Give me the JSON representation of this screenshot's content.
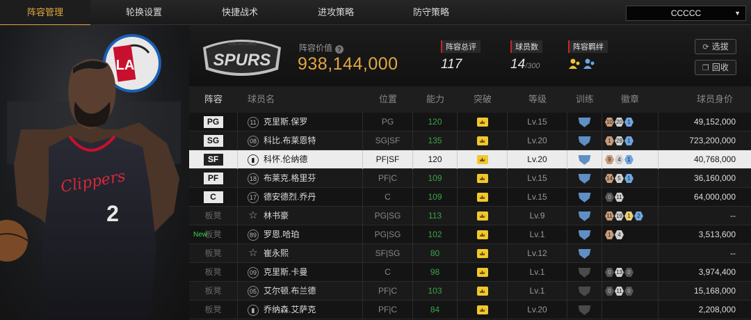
{
  "tabs": [
    {
      "label": "阵容管理",
      "active": true
    },
    {
      "label": "轮换设置"
    },
    {
      "label": "快捷战术"
    },
    {
      "label": "进攻策略"
    },
    {
      "label": "防守策略"
    }
  ],
  "team_select": {
    "value": "CCCCC"
  },
  "info": {
    "logo_text": "SPURS",
    "logo_arc": "SAN ANTONIO",
    "value_label": "阵容价值",
    "value": "938,144,000",
    "stats": [
      {
        "label": "阵容总评",
        "value": "117",
        "suffix": ""
      },
      {
        "label": "球员数",
        "value": "14",
        "suffix": "/300"
      },
      {
        "label": "阵容羁绊",
        "value": "",
        "suffix": ""
      }
    ],
    "buttons": {
      "select": "选拔",
      "recycle": "回收"
    }
  },
  "portrait": {
    "jersey_text": "Clippers",
    "jersey_number": "2",
    "logo_letters": "LA"
  },
  "table": {
    "headers": [
      "阵容",
      "球员名",
      "位置",
      "能力",
      "突破",
      "等级",
      "训练",
      "徽章",
      "球员身价"
    ],
    "rows": [
      {
        "slot": "PG",
        "starter": true,
        "num": "11",
        "name": "克里斯.保罗",
        "pos": "PG",
        "ability": "120",
        "green": true,
        "level": "Lv.15",
        "train": "blue",
        "badges": [
          [
            "b",
            "10"
          ],
          [
            "s",
            "20"
          ],
          [
            "bl",
            "1"
          ]
        ],
        "price": "49,152,000"
      },
      {
        "slot": "SG",
        "starter": true,
        "num": "08",
        "name": "科比.布莱恩特",
        "pos": "SG|SF",
        "ability": "135",
        "green": true,
        "level": "Lv.20",
        "train": "blue",
        "badges": [
          [
            "b",
            "1"
          ],
          [
            "s",
            "29"
          ],
          [
            "bl",
            "1"
          ]
        ],
        "price": "723,200,000"
      },
      {
        "slot": "SF",
        "starter": true,
        "selected": true,
        "num": "il",
        "name": "科怀.伦纳德",
        "pos": "PF|SF",
        "ability": "120",
        "green": false,
        "level": "Lv.20",
        "train": "blue",
        "badges": [
          [
            "b",
            "9"
          ],
          [
            "s",
            "4"
          ],
          [
            "bl",
            "1"
          ]
        ],
        "price": "40,768,000"
      },
      {
        "slot": "PF",
        "starter": true,
        "num": "18",
        "name": "布莱克.格里芬",
        "pos": "PF|C",
        "ability": "109",
        "green": true,
        "level": "Lv.15",
        "train": "blue",
        "badges": [
          [
            "b",
            "14"
          ],
          [
            "s",
            "5"
          ],
          [
            "bl",
            "1"
          ]
        ],
        "price": "36,160,000"
      },
      {
        "slot": "C",
        "starter": true,
        "num": "17",
        "name": "德安德烈.乔丹",
        "pos": "C",
        "ability": "109",
        "green": true,
        "level": "Lv.15",
        "train": "blue",
        "badges": [
          [
            "k",
            "0"
          ],
          [
            "s",
            "11"
          ]
        ],
        "price": "64,000,000"
      },
      {
        "slot": "板凳",
        "starter": false,
        "num": "☆",
        "name": "林书豪",
        "pos": "PG|SG",
        "ability": "113",
        "green": true,
        "level": "Lv.9",
        "train": "blue",
        "badges": [
          [
            "b",
            "11"
          ],
          [
            "s",
            "19"
          ],
          [
            "g",
            "1"
          ],
          [
            "bl",
            "2"
          ]
        ],
        "price": "--"
      },
      {
        "slot": "板凳",
        "starter": false,
        "isnew": true,
        "new_label": "New",
        "num": "89",
        "name": "罗恩.哈珀",
        "pos": "PG|SG",
        "ability": "102",
        "green": true,
        "level": "Lv.1",
        "train": "blue",
        "badges": [
          [
            "b",
            "1"
          ],
          [
            "s",
            "4"
          ]
        ],
        "price": "3,513,600"
      },
      {
        "slot": "板凳",
        "starter": false,
        "num": "☆",
        "name": "崔永熙",
        "pos": "SF|SG",
        "ability": "80",
        "green": true,
        "level": "Lv.12",
        "train": "blue",
        "badges": [],
        "price": "--"
      },
      {
        "slot": "板凳",
        "starter": false,
        "num": "09",
        "name": "克里斯.卡曼",
        "pos": "C",
        "ability": "98",
        "green": true,
        "level": "Lv.1",
        "train": "gray",
        "badges": [
          [
            "k",
            "0"
          ],
          [
            "s",
            "13"
          ],
          [
            "k",
            "0"
          ]
        ],
        "price": "3,974,400"
      },
      {
        "slot": "板凳",
        "starter": false,
        "num": "05",
        "name": "艾尔顿.布兰德",
        "pos": "PF|C",
        "ability": "103",
        "green": true,
        "level": "Lv.1",
        "train": "gray",
        "badges": [
          [
            "k",
            "0"
          ],
          [
            "s",
            "11"
          ],
          [
            "k",
            "0"
          ]
        ],
        "price": "15,168,000"
      },
      {
        "slot": "板凳",
        "starter": false,
        "num": "il",
        "name": "乔纳森.艾萨克",
        "pos": "PF|C",
        "ability": "84",
        "green": true,
        "level": "Lv.20",
        "train": "gray",
        "badges": [],
        "price": "2,208,000"
      }
    ]
  }
}
